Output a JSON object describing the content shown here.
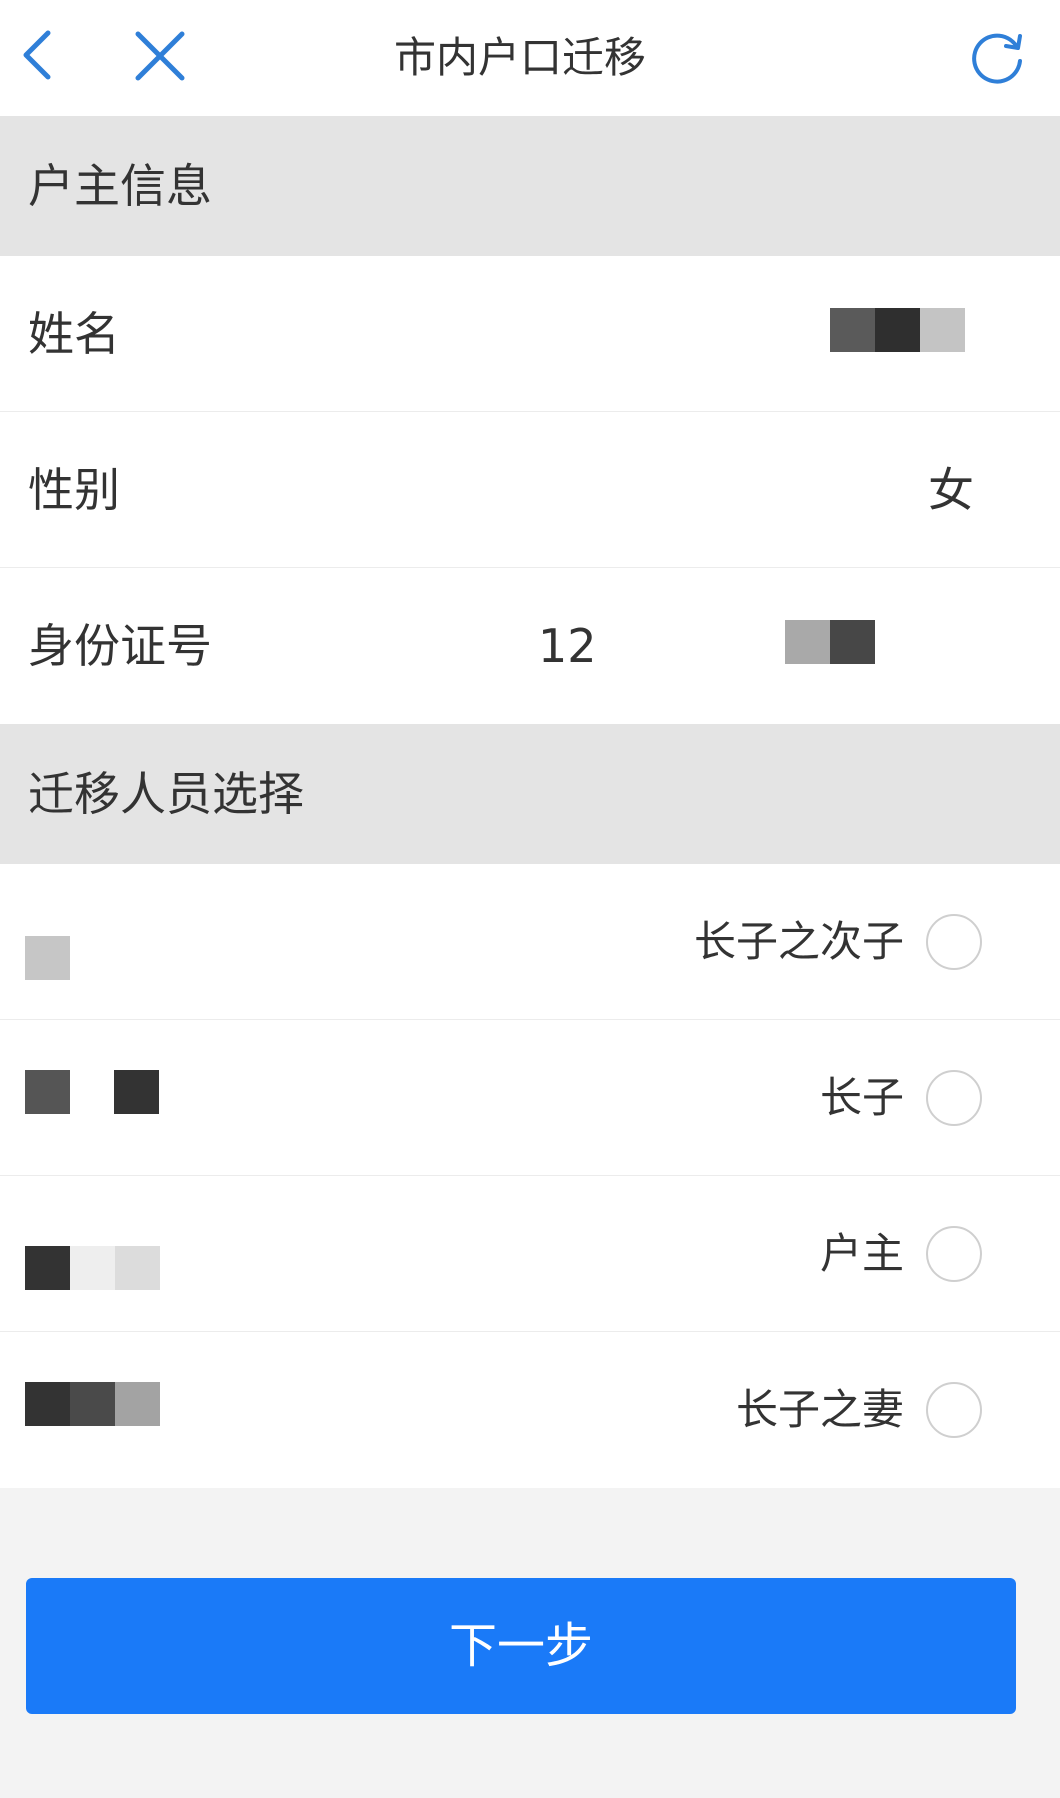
{
  "header": {
    "title": "市内户口迁移",
    "back_icon": "chevron-left-icon",
    "close_icon": "close-icon",
    "refresh_icon": "refresh-icon",
    "accent_color": "#2f7fd8"
  },
  "householder_section": {
    "title": "户主信息",
    "fields": {
      "name_label": "姓名",
      "gender_label": "性别",
      "gender_value": "女",
      "id_label": "身份证号",
      "id_value_visible": "12"
    }
  },
  "migration_section": {
    "title": "迁移人员选择",
    "members": [
      {
        "relation": "长子之次子",
        "selected": false
      },
      {
        "relation": "长子",
        "selected": false
      },
      {
        "relation": "户主",
        "selected": false
      },
      {
        "relation": "长子之妻",
        "selected": false
      }
    ]
  },
  "footer": {
    "next_label": "下一步",
    "button_color": "#1a7af8"
  }
}
